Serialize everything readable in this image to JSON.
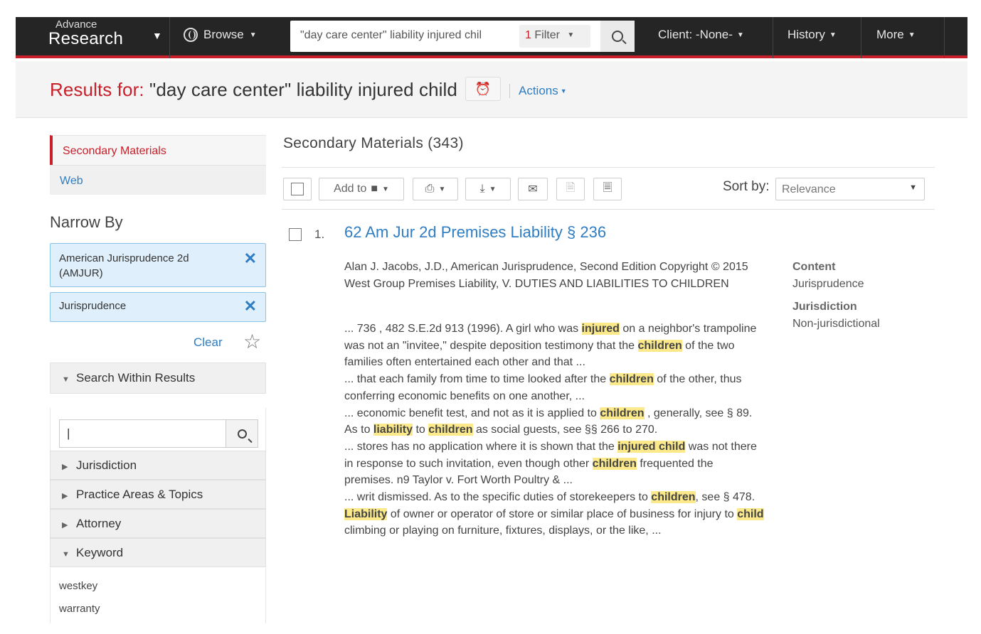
{
  "header": {
    "brand_sup": "Advance",
    "brand_main": "Research",
    "browse": "Browse",
    "query": "\"day care center\" liability injured chil",
    "filter_count": "1",
    "filter_label": "Filter",
    "client": "Client: -None-",
    "history": "History",
    "more": "More"
  },
  "results": {
    "label": "Results for:",
    "query": " \"day care center\" liability injured child",
    "actions": "Actions"
  },
  "sidebar": {
    "tabs": [
      "Secondary Materials",
      "Web"
    ],
    "narrow_by": "Narrow By",
    "filters": [
      "American Jurisprudence 2d (AMJUR)",
      "Jurisprudence"
    ],
    "clear": "Clear",
    "search_within": "Search Within Results",
    "search_value": "|",
    "sections": [
      "Jurisdiction",
      "Practice Areas & Topics",
      "Attorney",
      "Keyword"
    ],
    "keywords": [
      "westkey",
      "warranty"
    ]
  },
  "main": {
    "heading": "Secondary Materials (343)",
    "toolbar": {
      "add_to": "Add to"
    },
    "sort_label": "Sort by:",
    "sort_value": "Relevance",
    "result": {
      "number": "1.",
      "title": "62 Am Jur 2d Premises Liability § 236",
      "meta": "Alan J. Jacobs, J.D., American Jurisprudence, Second Edition Copyright © 2015 West Group Premises Liability, V. DUTIES AND LIABILITIES TO CHILDREN",
      "snippets": [
        [
          "... 736 , 482 S.E.2d 913 (1996). A girl who was ",
          "injured",
          " on a neighbor's trampoline was not an \"invitee,\" despite deposition testimony that the ",
          "children",
          " of the two families often entertained each other and that ..."
        ],
        [
          "... that each family from time to time looked after the ",
          "children",
          " of the other, thus conferring economic benefits on one another, ..."
        ],
        [
          "... economic benefit test, and not as it is applied to ",
          "children",
          " , generally, see § 89. As to ",
          "liability",
          " to ",
          "children",
          " as social guests, see §§ 266 to 270."
        ],
        [
          "... stores has no application where it is shown that the ",
          "injured child",
          " was not there in response to such invitation, even though other ",
          "children",
          " frequented the premises. n9 Taylor v. Fort Worth Poultry & ..."
        ],
        [
          "... writ dismissed. As to the specific duties of storekeepers to ",
          "children",
          ", see § 478."
        ],
        [
          "",
          "Liability",
          " of owner or operator of store or similar place of business for injury to ",
          "child",
          " climbing or playing on furniture, fixtures, displays, or the like, ..."
        ]
      ],
      "content_label": "Content",
      "content_value": "Jurisprudence",
      "jurisdiction_label": "Jurisdiction",
      "jurisdiction_value": "Non-jurisdictional"
    }
  }
}
